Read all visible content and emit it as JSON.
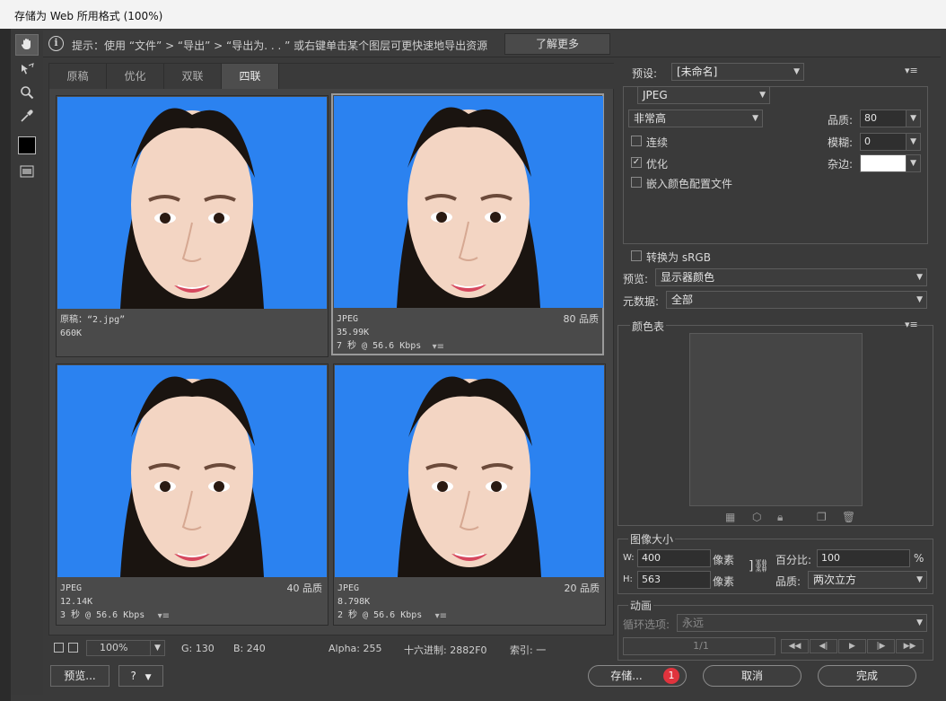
{
  "window": {
    "title": "存储为 Web 所用格式 (100%)"
  },
  "hint": {
    "text": "提示：使用 “文件” > “导出” > “导出为. . . ” 或右键单击某个图层可更快速地导出资源",
    "learn_more": "了解更多"
  },
  "tabs": [
    "原稿",
    "优化",
    "双联",
    "四联"
  ],
  "active_tab": "四联",
  "panes": [
    {
      "line1": "原稿：“2.jpg”",
      "line2": "660K",
      "line3": "",
      "quality": "",
      "menu": false
    },
    {
      "line1": "JPEG",
      "line2": "35.99K",
      "line3": "7 秒 @ 56.6 Kbps",
      "quality": "80 品质",
      "menu": true
    },
    {
      "line1": "JPEG",
      "line2": "12.14K",
      "line3": "3 秒 @ 56.6 Kbps",
      "quality": "40 品质",
      "menu": true
    },
    {
      "line1": "JPEG",
      "line2": "8.798K",
      "line3": "2 秒 @ 56.6 Kbps",
      "quality": "20 品质",
      "menu": true
    }
  ],
  "status": {
    "zoom": "100%",
    "g": "G: 130",
    "b": "B: 240",
    "alpha": "Alpha: 255",
    "hex": "十六进制: 2882F0",
    "index": "索引: 一"
  },
  "buttons": {
    "preview": "预览...",
    "save": "存储...",
    "save_badge": "1",
    "cancel": "取消",
    "done": "完成"
  },
  "settings": {
    "preset_label": "预设:",
    "preset_value": "[未命名]",
    "format": "JPEG",
    "quality_preset": "非常高",
    "quality_label": "品质:",
    "quality_value": "80",
    "blur_label": "模糊:",
    "blur_value": "0",
    "matte_label": "杂边:",
    "progressive": "连续",
    "optimized": "优化",
    "embed_profile": "嵌入颜色配置文件",
    "convert_srgb": "转换为 sRGB",
    "preview_label": "预览:",
    "preview_value": "显示器颜色",
    "metadata_label": "元数据:",
    "metadata_value": "全部"
  },
  "color_table": {
    "title": "颜色表"
  },
  "image_size": {
    "title": "图像大小",
    "w_label": "W:",
    "w_value": "400",
    "h_label": "H:",
    "h_value": "563",
    "unit": "像素",
    "percent_label": "百分比:",
    "percent_value": "100",
    "percent_unit": "%",
    "quality_label": "品质:",
    "quality_value": "两次立方"
  },
  "animation": {
    "title": "动画",
    "loop_label": "循环选项:",
    "loop_value": "永远",
    "frame": "1/1"
  },
  "colors": {
    "photo_bg": "#2b82f0",
    "badge": "#e0333d"
  }
}
